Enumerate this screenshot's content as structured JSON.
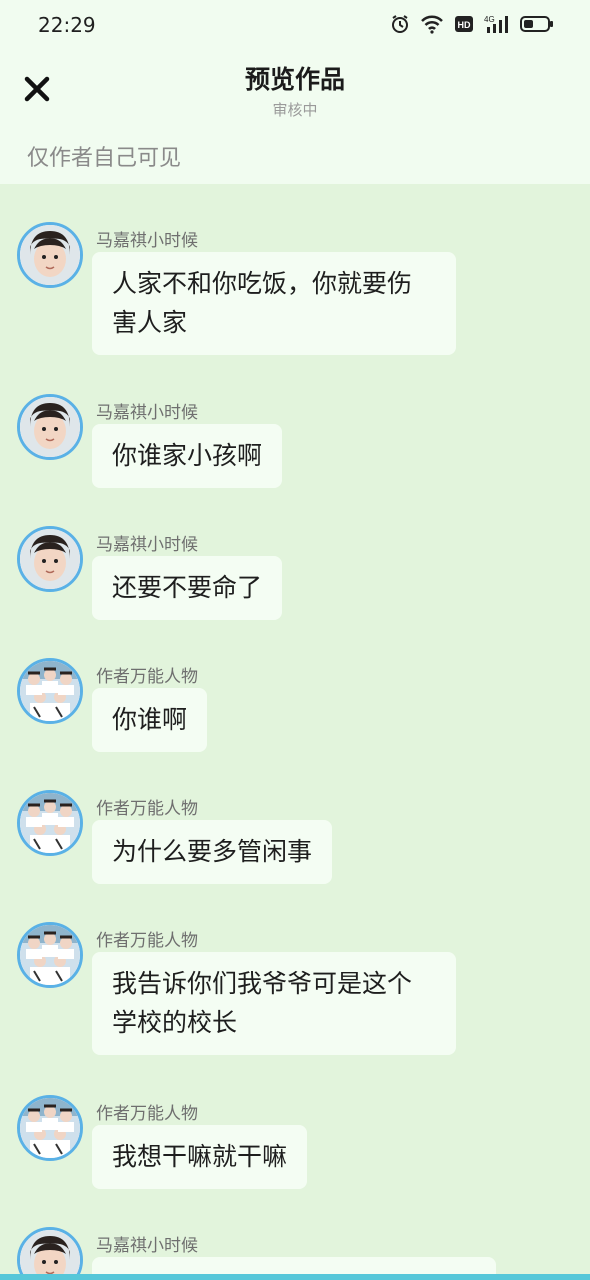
{
  "status_bar": {
    "time": "22:29",
    "icons": [
      "alarm-icon",
      "wifi-icon",
      "hd-icon",
      "signal-4g-icon",
      "battery-icon"
    ]
  },
  "header": {
    "close_icon": "close-icon",
    "title": "预览作品",
    "subtitle": "审核中",
    "visibility_note": "仅作者自己可见"
  },
  "colors": {
    "header_bg": "#f1fcf0",
    "chat_bg": "#e2f4dc",
    "bubble_bg": "#f4fdf3",
    "avatar_ring": "#5ab1e6"
  },
  "messages": [
    {
      "sender": "马嘉祺小时候",
      "avatar": "child-avatar",
      "text": "人家不和你吃饭，你就要伤害人家"
    },
    {
      "sender": "马嘉祺小时候",
      "avatar": "child-avatar",
      "text": "你谁家小孩啊"
    },
    {
      "sender": "马嘉祺小时候",
      "avatar": "child-avatar",
      "text": "还要不要命了"
    },
    {
      "sender": "作者万能人物",
      "avatar": "group-avatar",
      "text": "你谁啊"
    },
    {
      "sender": "作者万能人物",
      "avatar": "group-avatar",
      "text": "为什么要多管闲事"
    },
    {
      "sender": "作者万能人物",
      "avatar": "group-avatar",
      "text": "我告诉你们我爷爷可是这个学校的校长"
    },
    {
      "sender": "作者万能人物",
      "avatar": "group-avatar",
      "text": "我想干嘛就干嘛"
    },
    {
      "sender": "马嘉祺小时候",
      "avatar": "child-avatar",
      "text": ""
    }
  ]
}
